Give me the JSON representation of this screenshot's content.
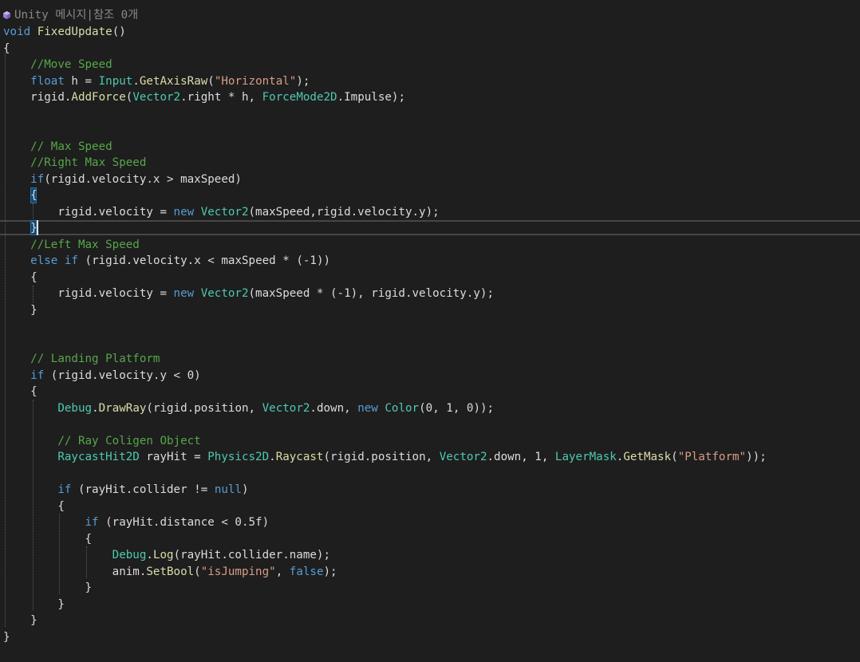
{
  "codelens": {
    "icon": "unity-icon",
    "text": "Unity 메시지|참조 0개"
  },
  "lines": [
    [
      [
        "void",
        "kw"
      ],
      [
        " ",
        "tx"
      ],
      [
        "FixedUpdate",
        "me"
      ],
      [
        "()",
        "tx"
      ]
    ],
    [
      [
        "{",
        "tx"
      ]
    ],
    [
      [
        "    ",
        "tx"
      ],
      [
        "//Move Speed",
        "cm"
      ]
    ],
    [
      [
        "    ",
        "tx"
      ],
      [
        "float",
        "kw"
      ],
      [
        " h = ",
        "tx"
      ],
      [
        "Input",
        "ty"
      ],
      [
        ".",
        "tx"
      ],
      [
        "GetAxisRaw",
        "me"
      ],
      [
        "(",
        "tx"
      ],
      [
        "\"Horizontal\"",
        "st"
      ],
      [
        ");",
        "tx"
      ]
    ],
    [
      [
        "    rigid.",
        "tx"
      ],
      [
        "AddForce",
        "me"
      ],
      [
        "(",
        "tx"
      ],
      [
        "Vector2",
        "ty"
      ],
      [
        ".right * h, ",
        "tx"
      ],
      [
        "ForceMode2D",
        "ty"
      ],
      [
        ".Impulse);",
        "tx"
      ]
    ],
    [],
    [],
    [
      [
        "    ",
        "tx"
      ],
      [
        "// Max Speed",
        "cm"
      ]
    ],
    [
      [
        "    ",
        "tx"
      ],
      [
        "//Right Max Speed",
        "cm"
      ]
    ],
    [
      [
        "    ",
        "tx"
      ],
      [
        "if",
        "kw"
      ],
      [
        "(rigid.velocity.x > maxSpeed)",
        "tx"
      ]
    ],
    [
      [
        "    ",
        "tx"
      ],
      [
        "{",
        "tx"
      ]
    ],
    [
      [
        "        rigid.velocity = ",
        "tx"
      ],
      [
        "new",
        "kw"
      ],
      [
        " ",
        "tx"
      ],
      [
        "Vector2",
        "ty"
      ],
      [
        "(maxSpeed,rigid.velocity.y);",
        "tx"
      ]
    ],
    [
      [
        "    ",
        "tx"
      ],
      [
        "}",
        "tx"
      ]
    ],
    [
      [
        "    ",
        "tx"
      ],
      [
        "//Left Max Speed",
        "cm"
      ]
    ],
    [
      [
        "    ",
        "tx"
      ],
      [
        "else",
        "kw"
      ],
      [
        " ",
        "tx"
      ],
      [
        "if",
        "kw"
      ],
      [
        " (rigid.velocity.x < maxSpeed * (-1))",
        "tx"
      ]
    ],
    [
      [
        "    ",
        "tx"
      ],
      [
        "{",
        "tx"
      ]
    ],
    [
      [
        "        rigid.velocity = ",
        "tx"
      ],
      [
        "new",
        "kw"
      ],
      [
        " ",
        "tx"
      ],
      [
        "Vector2",
        "ty"
      ],
      [
        "(maxSpeed * (-1), rigid.velocity.y);",
        "tx"
      ]
    ],
    [
      [
        "    ",
        "tx"
      ],
      [
        "}",
        "tx"
      ]
    ],
    [],
    [],
    [
      [
        "    ",
        "tx"
      ],
      [
        "// Landing Platform",
        "cm"
      ]
    ],
    [
      [
        "    ",
        "tx"
      ],
      [
        "if",
        "kw"
      ],
      [
        " (rigid.velocity.y < 0)",
        "tx"
      ]
    ],
    [
      [
        "    ",
        "tx"
      ],
      [
        "{",
        "tx"
      ]
    ],
    [
      [
        "        ",
        "tx"
      ],
      [
        "Debug",
        "ty"
      ],
      [
        ".",
        "tx"
      ],
      [
        "DrawRay",
        "me"
      ],
      [
        "(rigid.position, ",
        "tx"
      ],
      [
        "Vector2",
        "ty"
      ],
      [
        ".down, ",
        "tx"
      ],
      [
        "new",
        "kw"
      ],
      [
        " ",
        "tx"
      ],
      [
        "Color",
        "ty"
      ],
      [
        "(0, 1, 0));",
        "tx"
      ]
    ],
    [],
    [
      [
        "        ",
        "tx"
      ],
      [
        "// Ray Coligen Object",
        "cm"
      ]
    ],
    [
      [
        "        ",
        "tx"
      ],
      [
        "RaycastHit2D",
        "ty"
      ],
      [
        " rayHit = ",
        "tx"
      ],
      [
        "Physics2D",
        "ty"
      ],
      [
        ".",
        "tx"
      ],
      [
        "Raycast",
        "me"
      ],
      [
        "(rigid.position, ",
        "tx"
      ],
      [
        "Vector2",
        "ty"
      ],
      [
        ".down, 1, ",
        "tx"
      ],
      [
        "LayerMask",
        "ty"
      ],
      [
        ".",
        "tx"
      ],
      [
        "GetMask",
        "me"
      ],
      [
        "(",
        "tx"
      ],
      [
        "\"Platform\"",
        "st"
      ],
      [
        "));",
        "tx"
      ]
    ],
    [],
    [
      [
        "        ",
        "tx"
      ],
      [
        "if",
        "kw"
      ],
      [
        " (rayHit.collider != ",
        "tx"
      ],
      [
        "null",
        "kw"
      ],
      [
        ")",
        "tx"
      ]
    ],
    [
      [
        "        ",
        "tx"
      ],
      [
        "{",
        "tx"
      ]
    ],
    [
      [
        "            ",
        "tx"
      ],
      [
        "if",
        "kw"
      ],
      [
        " (rayHit.distance < 0.5f)",
        "tx"
      ]
    ],
    [
      [
        "            ",
        "tx"
      ],
      [
        "{",
        "tx"
      ]
    ],
    [
      [
        "                ",
        "tx"
      ],
      [
        "Debug",
        "ty"
      ],
      [
        ".",
        "tx"
      ],
      [
        "Log",
        "me"
      ],
      [
        "(rayHit.collider.name);",
        "tx"
      ]
    ],
    [
      [
        "                anim.",
        "tx"
      ],
      [
        "SetBool",
        "me"
      ],
      [
        "(",
        "tx"
      ],
      [
        "\"isJumping\"",
        "st"
      ],
      [
        ", ",
        "tx"
      ],
      [
        "false",
        "kw"
      ],
      [
        ");",
        "tx"
      ]
    ],
    [
      [
        "            ",
        "tx"
      ],
      [
        "}",
        "tx"
      ]
    ],
    [
      [
        "        ",
        "tx"
      ],
      [
        "}",
        "tx"
      ]
    ],
    [
      [
        "    ",
        "tx"
      ],
      [
        "}",
        "tx"
      ]
    ],
    [
      [
        "}",
        "tx"
      ]
    ]
  ]
}
